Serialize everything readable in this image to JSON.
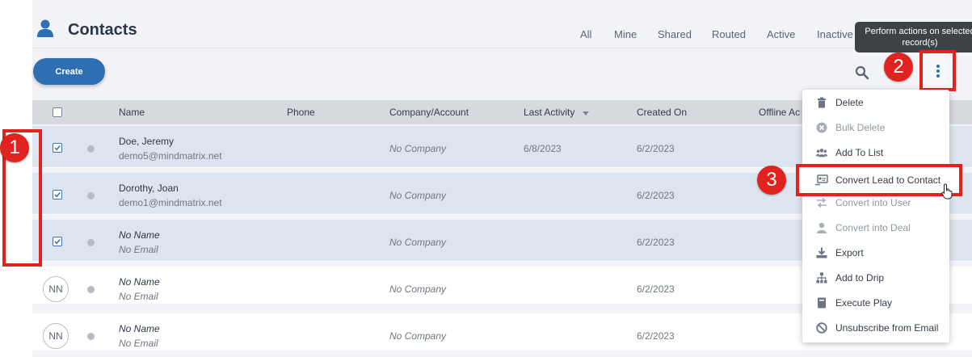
{
  "header": {
    "title": "Contacts",
    "icon": "person-icon",
    "filters": [
      "All",
      "Mine",
      "Shared",
      "Routed",
      "Active",
      "Inactive"
    ]
  },
  "toolbar": {
    "create_label": "Create",
    "search_icon": "search-icon",
    "more_icon": "kebab-icon",
    "tooltip": "Perform actions on selected record(s)"
  },
  "table": {
    "columns": [
      "Name",
      "Phone",
      "Company/Account",
      "Last Activity",
      "Created On",
      "Offline Ac"
    ],
    "rows": [
      {
        "selected": true,
        "initials": "",
        "name": "Doe, Jeremy",
        "email": "demo5@mindmatrix.net",
        "company": "No Company",
        "last_activity": "6/8/2023",
        "created_on": "6/2/2023"
      },
      {
        "selected": true,
        "initials": "",
        "name": "Dorothy, Joan",
        "email": "demo1@mindmatrix.net",
        "company": "No Company",
        "last_activity": "",
        "created_on": "6/2/2023"
      },
      {
        "selected": true,
        "initials": "",
        "name": "No Name",
        "email": "No Email",
        "company": "No Company",
        "last_activity": "",
        "created_on": "6/2/2023"
      },
      {
        "selected": false,
        "initials": "NN",
        "name": "No Name",
        "email": "No Email",
        "company": "No Company",
        "last_activity": "",
        "created_on": "6/2/2023"
      },
      {
        "selected": false,
        "initials": "NN",
        "name": "No Name",
        "email": "No Email",
        "company": "No Company",
        "last_activity": "",
        "created_on": "6/2/2023"
      }
    ]
  },
  "menu": {
    "items": [
      {
        "label": "Delete",
        "icon": "trash-icon",
        "enabled": true
      },
      {
        "label": "Bulk Delete",
        "icon": "circle-x-icon",
        "enabled": false
      },
      {
        "label": "Add To List",
        "icon": "users-icon",
        "enabled": true
      },
      {
        "label": "Convert Lead to Contact",
        "icon": "convert-card-icon",
        "enabled": true
      },
      {
        "label": "Convert into User",
        "icon": "swap-arrows-icon",
        "enabled": false
      },
      {
        "label": "Convert into Deal",
        "icon": "user-deal-icon",
        "enabled": false
      },
      {
        "label": "Export",
        "icon": "download-icon",
        "enabled": true
      },
      {
        "label": "Add to Drip",
        "icon": "sitemap-icon",
        "enabled": true
      },
      {
        "label": "Execute Play",
        "icon": "book-icon",
        "enabled": true
      },
      {
        "label": "Unsubscribe from Email",
        "icon": "ban-icon",
        "enabled": true
      }
    ]
  },
  "annotations": {
    "markers": [
      "1",
      "2",
      "3"
    ],
    "highlight_color": "#e0231e"
  },
  "colors": {
    "primary": "#2e6fb3",
    "selected_row": "#dce5ef",
    "header_row": "#d6d9de"
  }
}
